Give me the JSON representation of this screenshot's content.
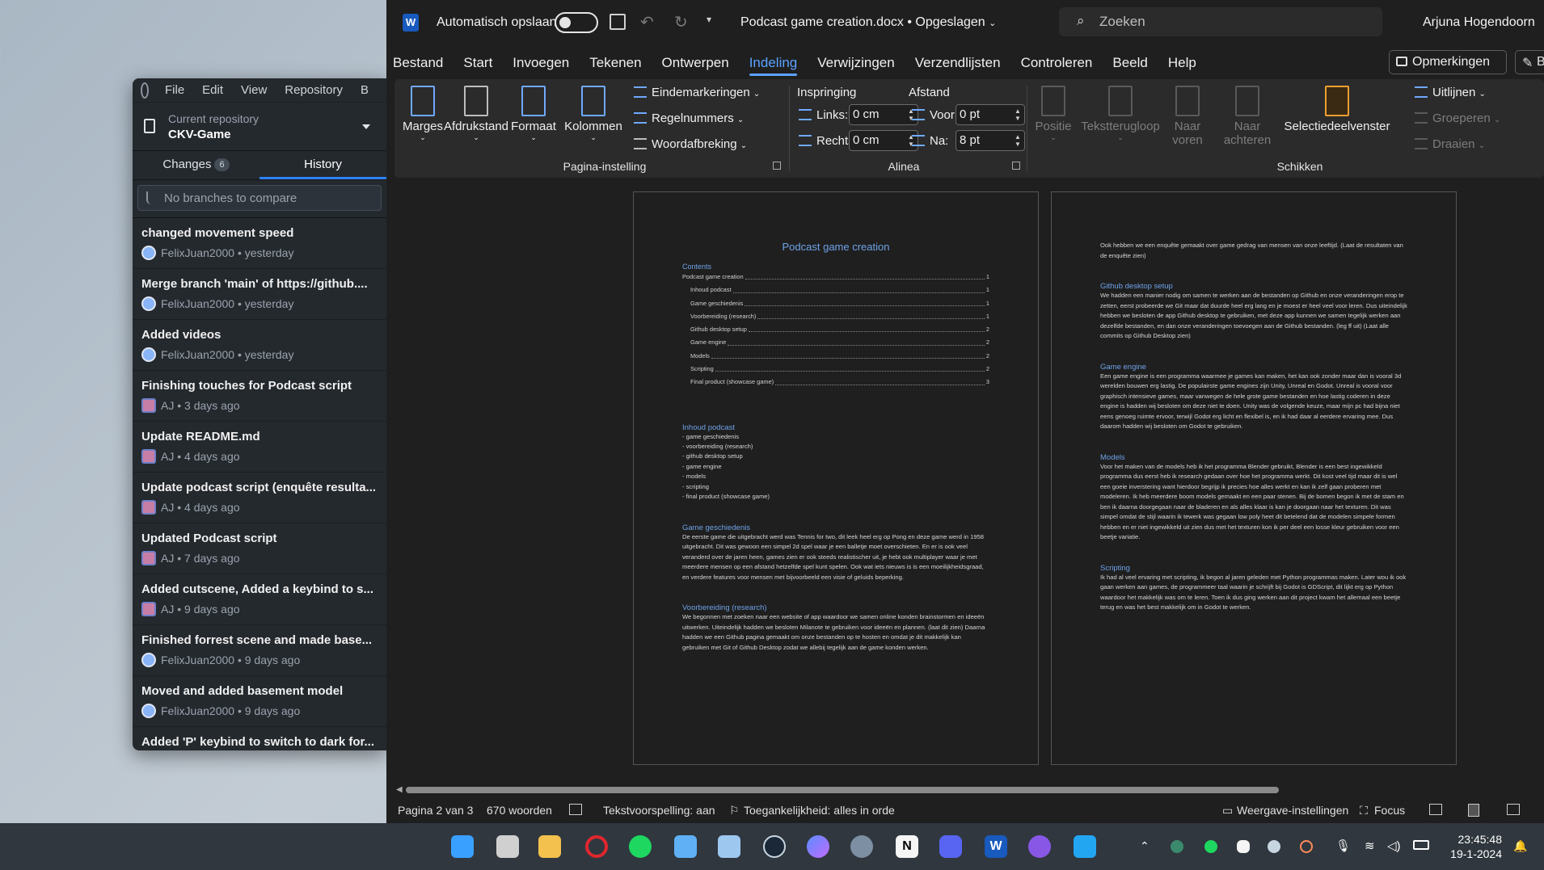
{
  "github": {
    "menu": [
      "File",
      "Edit",
      "View",
      "Repository",
      "B"
    ],
    "repo_label": "Current repository",
    "repo_name": "CKV-Game",
    "tabs": {
      "changes": "Changes",
      "changes_count": "6",
      "history": "History"
    },
    "branch_placeholder": "No branches to compare",
    "commits": [
      {
        "title": "changed movement speed",
        "meta": "FelixJuan2000 • yesterday",
        "avatar": "felix"
      },
      {
        "title": "Merge branch 'main' of https://github....",
        "meta": "FelixJuan2000 • yesterday",
        "avatar": "felix"
      },
      {
        "title": "Added videos",
        "meta": "FelixJuan2000 • yesterday",
        "avatar": "felix"
      },
      {
        "title": "Finishing touches for Podcast script",
        "meta": "AJ • 3 days ago",
        "avatar": "aj"
      },
      {
        "title": "Update README.md",
        "meta": "AJ • 4 days ago",
        "avatar": "aj"
      },
      {
        "title": "Update podcast script (enquête resulta...",
        "meta": "AJ • 4 days ago",
        "avatar": "aj"
      },
      {
        "title": "Updated Podcast script",
        "meta": "AJ • 7 days ago",
        "avatar": "aj"
      },
      {
        "title": "Added cutscene, Added a keybind to s...",
        "meta": "AJ • 9 days ago",
        "avatar": "aj"
      },
      {
        "title": "Finished forrest scene and made base...",
        "meta": "FelixJuan2000 • 9 days ago",
        "avatar": "felix"
      },
      {
        "title": "Moved and added basement model",
        "meta": "FelixJuan2000 • 9 days ago",
        "avatar": "felix"
      },
      {
        "title": "Added 'P' keybind to switch to dark for...",
        "meta": "",
        "avatar": ""
      }
    ]
  },
  "word": {
    "autosave": "Automatisch opslaan",
    "doc_title": "Podcast game creation.docx • Opgeslagen",
    "search_placeholder": "Zoeken",
    "user": "Arjuna Hogendoorn",
    "tabs": [
      "Bestand",
      "Start",
      "Invoegen",
      "Tekenen",
      "Ontwerpen",
      "Indeling",
      "Verwijzingen",
      "Verzendlijsten",
      "Controleren",
      "Beeld",
      "Help"
    ],
    "active_tab": "Indeling",
    "comments": "Opmerkingen",
    "edit_label": "B",
    "ribbon": {
      "marges": "Marges",
      "afdrukstand": "Afdrukstand",
      "formaat": "Formaat",
      "kolommen": "Kolommen",
      "eindemarkeringen": "Eindemarkeringen",
      "regelnummers": "Regelnummers",
      "woordafbreking": "Woordafbreking",
      "group_pagina": "Pagina-instelling",
      "inspringing": "Inspringing",
      "afstand": "Afstand",
      "links": "Links:",
      "links_val": "0 cm",
      "rechts": "Rechts:",
      "rechts_val": "0 cm",
      "voor": "Voor:",
      "voor_val": "0 pt",
      "na": "Na:",
      "na_val": "8 pt",
      "group_alinea": "Alinea",
      "positie": "Positie",
      "tekstterugloop": "Tekstterugloop",
      "naar_voren_1": "Naar",
      "naar_voren_2": "voren",
      "naar_achteren_1": "Naar",
      "naar_achteren_2": "achteren",
      "selectiedeelvenster": "Selectiedeelvenster",
      "uitlijnen": "Uitlijnen",
      "groeperen": "Groeperen",
      "draaien": "Draaien",
      "group_schikken": "Schikken"
    },
    "page1": {
      "title": "Podcast game creation",
      "contents_heading": "Contents",
      "toc": [
        {
          "text": "Podcast game creation",
          "page": "1",
          "indent": false
        },
        {
          "text": "Inhoud podcast",
          "page": "1",
          "indent": true
        },
        {
          "text": "Game geschiedenis",
          "page": "1",
          "indent": true
        },
        {
          "text": "Voorbereiding (research)",
          "page": "1",
          "indent": true
        },
        {
          "text": "Github desktop setup",
          "page": "2",
          "indent": true
        },
        {
          "text": "Game engine",
          "page": "2",
          "indent": true
        },
        {
          "text": "Models",
          "page": "2",
          "indent": true
        },
        {
          "text": "Scripting",
          "page": "2",
          "indent": true
        },
        {
          "text": "Final product (showcase game)",
          "page": "3",
          "indent": true
        }
      ],
      "inhoud_heading": "Inhoud podcast",
      "inhoud_list": [
        "- game geschiedenis",
        "- voorbereiding (research)",
        "- github desktop setup",
        "- game engine",
        "- models",
        "- scripting",
        "- final product (showcase game)"
      ],
      "gesch_heading": "Game geschiedenis",
      "gesch_text": "De eerste game die uitgebracht werd was Tennis for two, dit leek heel erg op Pong en deze game werd in 1958 uitgebracht. Dit was gewoon een simpel 2d spel waar je een balletje moet overschieten. En er is ook veel veranderd over de jaren heen, games zien er ook steeds realistischer uit, je hebt ook multiplayer waar je met meerdere mensen op een afstand hetzelfde spel kunt spelen. Ook wat iets nieuws is is een moeilijkheidsgraad, en verdere features voor mensen met bijvoorbeeld een visie of geluids beperking.",
      "voorb_heading": "Voorbereiding (research)",
      "voorb_text": "We begonnen met zoeken naar een website of app waardoor we samen online konden brainstormen en ideeën uitwerken. Uiteindelijk hadden we besloten Milanote te gebruiken voor ideeën en plannen. (laat dit zien) Daarna hadden we een Github pagina gemaakt om onze bestanden op te hosten en omdat je dit makkelijk kan gebruiken met Git of Github Desktop zodat we allebij tegelijk aan de game konden werken."
    },
    "page2": {
      "intro": "Ook hebben we een enquête gemaakt over game gedrag van mensen van onze leeftijd. (Laat de resultaten van de enquête zien)",
      "github_heading": "Github desktop setup",
      "github_text": "We hadden een manier nodig om samen te werken aan de bestanden op Github en onze veranderingen erop te zetten, eerst probeerde we Git maar dat duurde heel erg lang en je moest er heel veel voor leren. Dus uiteindelijk hebben we besloten de app Github desktop te gebruiken, met deze app kunnen we samen tegelijk werken aan dezelfde bestanden, en dan onze veranderingen toevoegen aan de Github bestanden. (leg ff uit) (Laat alle commits op Github Desktop zien)",
      "engine_heading": "Game engine",
      "engine_text": "Een game engine is een programma waarmee je games kan maken, het kan ook zonder maar dan is vooral 3d werelden bouwen erg lastig. De populairste game engines zijn Unity, Unreal en Godot. Unreal is vooral voor graphisch intensieve games, maar vanwegen de hele grote game bestanden en hoe lastig coderen in deze engine is hadden wij besloten om deze niet te doen. Unity was de volgende keuze, maar mijn pc had bijna niet eens genoeg ruimte ervoor, terwijl Godot erg licht en flexibel is, en ik had daar al eerdere ervaring mee. Dus daarom hadden wij besloten om Godot te gebruiken.",
      "models_heading": "Models",
      "models_text": "Voor het maken van de models heb ik het programma Blender gebruikt, Blender is een best ingewikkeld programma dus eerst heb ik research gedaan over hoe het programma werkt. Dit kost veel tijd maar dit is wel een goeie inverstering want hierdoor begrijp ik precies hoe alles werkt en kan ik zelf gaan proberen met modeleren. Ik heb meerdere boom models gemaakt en een paar stenen. Bij de bomen begon ik met de stam en ben ik daarna doorgegaan naar de bladeren en als alles klaar is kan je doorgaan naar het texturen. Dit was simpel omdat de stijl waarin ik tewerk was gegaan low poly heet dit betelend dat de modelen simpele formen hebben en er niet ingewikkeld uit zien dus met het texturen kon ik per deel een losse kleur gebruiken voor een beetje variatie.",
      "scripting_heading": "Scripting",
      "scripting_text": "Ik had al veel ervaring met scripting, ik begon al jaren geleden met Python programmas maken. Later wou ik ook gaan werken aan games, de programmeer taal waarin je schrijft bij Godot is GDScript, dit lijkt erg op Python waardoor het makkelijk was om te leren. Toen ik dus ging werken aan dit project kwam het allemaal een beetje terug en was het best makkelijk om in Godot te werken."
    },
    "status": {
      "page": "Pagina 2 van 3",
      "words": "670 woorden",
      "predict": "Tekstvoorspelling: aan",
      "access": "Toegankelijkheid: alles in orde",
      "display": "Weergave-instellingen",
      "focus": "Focus"
    }
  },
  "taskbar": {
    "time": "23:45:48",
    "date": "19-1-2024",
    "icons": [
      "windows-icon",
      "task-view-icon",
      "file-explorer-icon",
      "opera-icon",
      "spotify-icon",
      "notepad-icon",
      "photos-icon",
      "steam-icon",
      "copilot-icon",
      "settings-icon",
      "notion-icon",
      "discord-icon",
      "word-icon",
      "github-desktop-icon",
      "vscode-icon"
    ],
    "colors": {
      "accent": "#2f81f7",
      "word": "#185abd",
      "link": "#6fa3e8"
    }
  }
}
